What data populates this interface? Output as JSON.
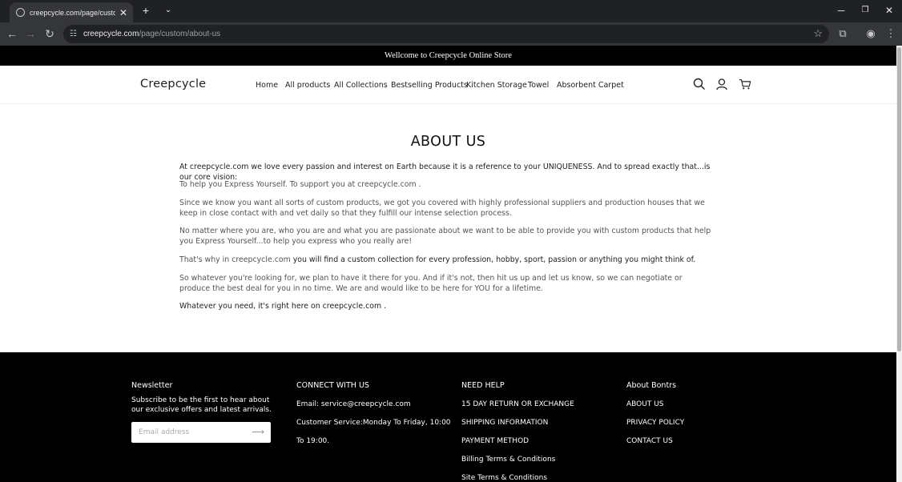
{
  "browser": {
    "tab_title": "creepcycle.com/page/custom/about-us",
    "url_host": "creepcycle.com",
    "url_path": "/page/custom/about-us"
  },
  "announcement": "Wellcome to Creepcycle Online Store",
  "header": {
    "logo": "Creepcycle",
    "nav": [
      "Home",
      "All products",
      "All Collections",
      "Bestselling Products",
      "Kitchen Storage",
      "Towel",
      "Absorbent Carpet"
    ]
  },
  "about": {
    "title": "ABOUT US",
    "p1": "At creepcycle.com  we love every passion and interest on Earth because it is a reference to your UNIQUENESS. And to spread exactly that...is our core vision:",
    "p2": "To help you Express Yourself. To support you at creepcycle.com .",
    "p3": "Since we know you want all sorts of custom products, we got you covered with highly professional suppliers and production houses that we keep in close contact with and vet daily so that they fulfill our intense selection process.",
    "p4": "No matter where you are, who you are and what you are passionate about we want to be able to provide you with custom products that help you Express Yourself...to help you express who you really are!",
    "p5_a": "That's why in creepcycle.com ",
    "p5_b": " you will find a custom collection for every profession, hobby, sport, passion or anything you might think of.",
    "p6": "So whatever you're looking for, we plan to have it there for you. And if it's not, then hit us up and let us know, so we can negotiate or produce the best deal for you in no time. We are and would like to be here for YOU for a lifetime.",
    "p7": "Whatever you need, it's right here on creepcycle.com ."
  },
  "footer": {
    "newsletter": {
      "title": "Newsletter",
      "text": "Subscribe to be the first to hear about our exclusive offers and latest arrivals.",
      "placeholder": "Email address"
    },
    "connect": {
      "title": "CONNECT WITH US",
      "email": "Email: service@creepcycle.com",
      "service_1": "Customer Service:Monday To Friday, 10:00",
      "service_2": "To 19:00."
    },
    "help": {
      "title": "NEED HELP",
      "links": [
        "15 DAY RETURN OR EXCHANGE",
        "SHIPPING INFORMATION",
        "PAYMENT METHOD",
        "Billing Terms & Conditions",
        "Site Terms & Conditions"
      ]
    },
    "about": {
      "title": "About Bontrs",
      "links": [
        "ABOUT US",
        "PRIVACY POLICY",
        "CONTACT US"
      ]
    }
  }
}
